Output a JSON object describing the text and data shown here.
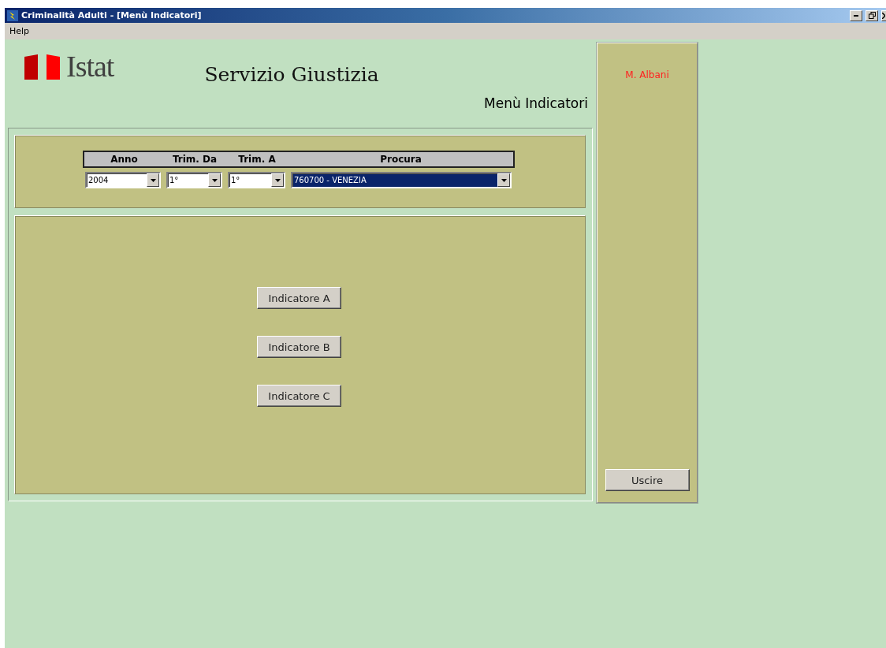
{
  "window": {
    "title": "Criminalità Adulti - [Menù Indicatori]"
  },
  "menu": [
    "Help"
  ],
  "logo": {
    "text": "Istat"
  },
  "app_title": "Servizio Giustizia",
  "page_title": "Menù Indicatori",
  "filters": [
    {
      "label": "Anno",
      "value": "2004",
      "focused": false
    },
    {
      "label": "Trim. Da",
      "value": "1°",
      "focused": false
    },
    {
      "label": "Trim. A",
      "value": "1°",
      "focused": false
    },
    {
      "label": "Procura",
      "value": "760700 - VENEZIA",
      "focused": true
    }
  ],
  "buttons": [
    "Indicatore A",
    "Indicatore B",
    "Indicatore C"
  ],
  "user": "M. Albani",
  "exit_button": "Uscire"
}
